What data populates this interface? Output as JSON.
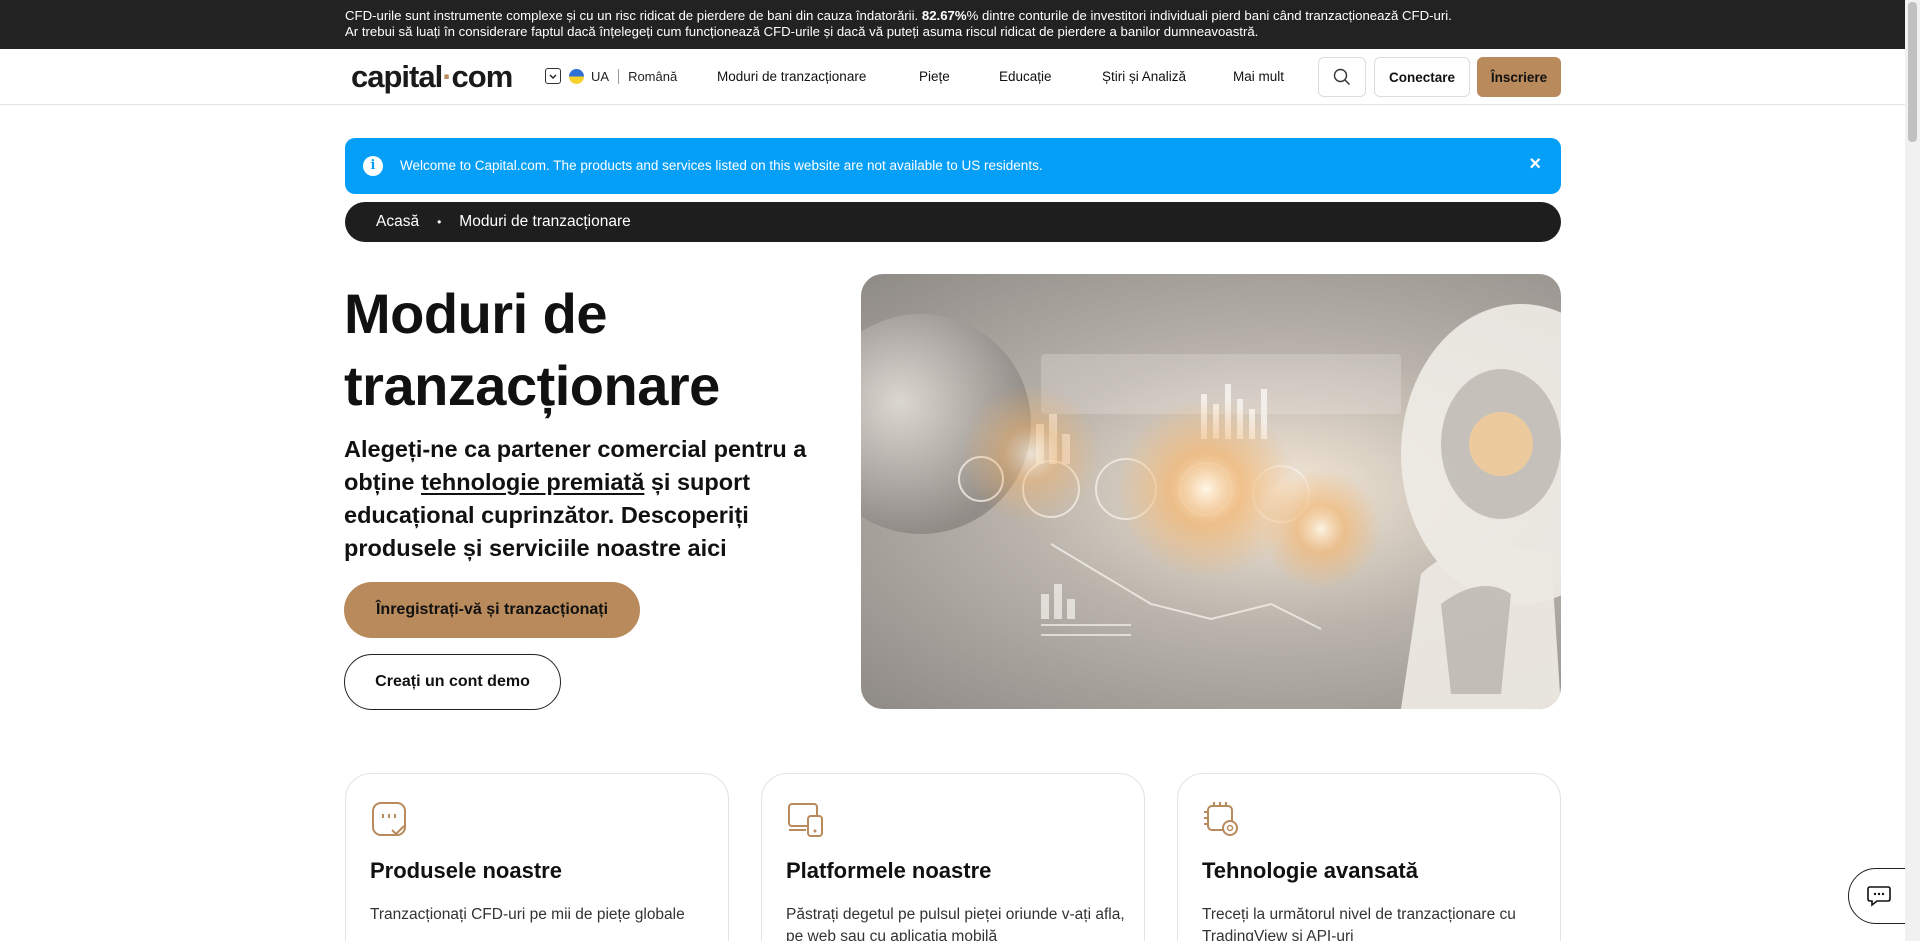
{
  "risk_banner": {
    "text_before": "CFD-urile sunt instrumente complexe și cu un risc ridicat de pierdere de bani din cauza îndatorării. ",
    "percent": "82.67%",
    "text_after": "% dintre conturile de investitori individuali pierd bani când tranzacționează CFD-uri.",
    "line2": "Ar trebui să luați în considerare faptul dacă înțelegeți cum funcționează CFD-urile și dacă vă puteți asuma riscul ridicat de pierdere a banilor dumneavoastră."
  },
  "header": {
    "logo_left": "capital",
    "logo_dot": "·",
    "logo_right": "com",
    "country": "UA",
    "language": "Română",
    "nav": [
      "Moduri de tranzacționare",
      "Piețe",
      "Educație",
      "Știri și Analiză",
      "Mai mult"
    ],
    "login_label": "Conectare",
    "signup_label": "Înscriere"
  },
  "info_bar": {
    "icon": "i",
    "text": "Welcome to Capital.com. The products and services listed on this website are not available to US residents.",
    "close": "×"
  },
  "breadcrumb": {
    "home": "Acasă",
    "separator": "•",
    "current": "Moduri de tranzacționare"
  },
  "hero": {
    "title": "Moduri de tranzacționare",
    "subtitle_1": "Alegeți-ne ca partener comercial pentru a obține ",
    "subtitle_link": "tehnologie premiată",
    "subtitle_2": " și suport educațional cuprinzător. Descoperiți produsele și serviciile noastre aici",
    "primary_button": "Înregistrați-vă și tranzacționați",
    "secondary_button": "Creați un cont demo"
  },
  "cards": [
    {
      "title": "Produsele noastre",
      "text": "Tranzacționați CFD-uri pe mii de piețe globale",
      "icon": "products-icon"
    },
    {
      "title": "Platformele noastre",
      "text": "Păstrați degetul pe pulsul pieței oriunde v-ați afla, pe web sau cu aplicația mobilă",
      "icon": "platforms-icon"
    },
    {
      "title": "Tehnologie avansată",
      "text": "Treceți la următorul nivel de tranzacționare cu TradingView și API-uri",
      "icon": "technology-icon"
    }
  ],
  "colors": {
    "accent": "#b88a5c",
    "info": "#069ff7",
    "dark": "#1e1e1e"
  }
}
